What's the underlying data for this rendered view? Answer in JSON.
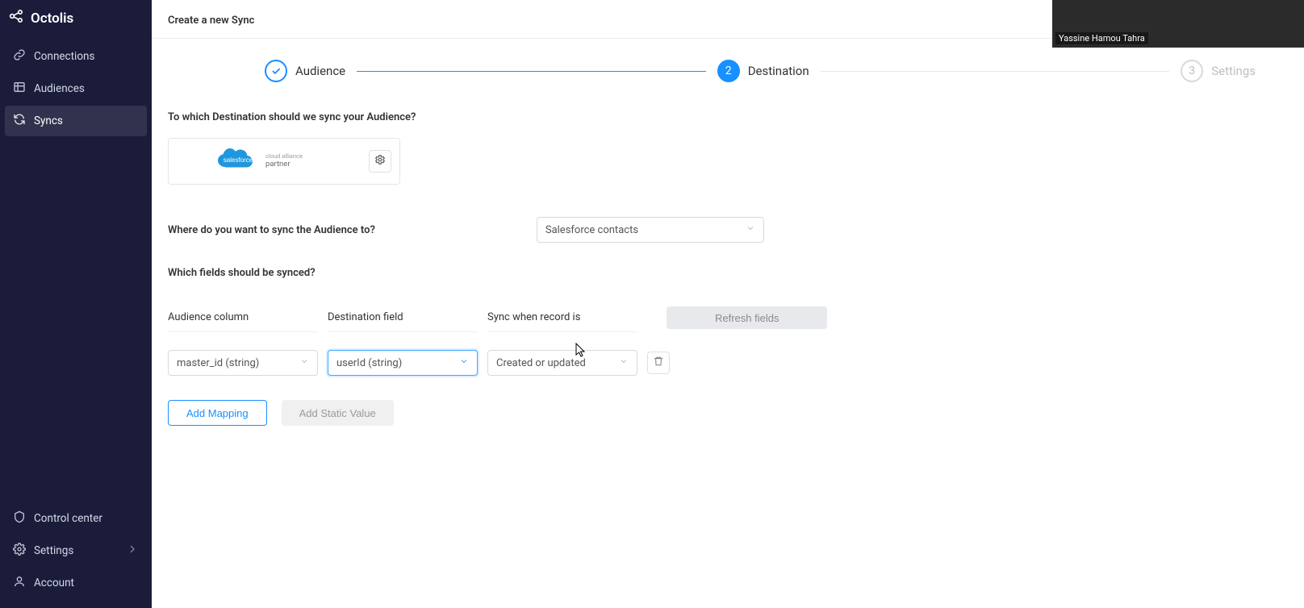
{
  "brand": "Octolis",
  "sidebar": {
    "items": [
      {
        "label": "Connections"
      },
      {
        "label": "Audiences"
      },
      {
        "label": "Syncs"
      }
    ],
    "bottom": [
      {
        "label": "Control center"
      },
      {
        "label": "Settings"
      },
      {
        "label": "Account"
      }
    ]
  },
  "header": {
    "title": "Create a new Sync"
  },
  "steps": {
    "s1": {
      "label": "Audience"
    },
    "s2": {
      "num": "2",
      "label": "Destination"
    },
    "s3": {
      "num": "3",
      "label": "Settings"
    }
  },
  "q1": "To which Destination should we sync your Audience?",
  "dest_card": {
    "cloud_text": "salesforce",
    "line1": "cloud alliance",
    "line2": "partner"
  },
  "q2": "Where do you want to sync the Audience to?",
  "sync_target": "Salesforce contacts",
  "q3": "Which fields should be synced?",
  "mapping_header": {
    "c1": "Audience column",
    "c2": "Destination field",
    "c3": "Sync when record is",
    "refresh": "Refresh fields"
  },
  "mapping_row": {
    "audience_col": "master_id (string)",
    "dest_field": "userId (string)",
    "sync_when": "Created or updated"
  },
  "actions": {
    "add_mapping": "Add Mapping",
    "add_static": "Add Static Value"
  },
  "webcam_name": "Yassine Hamou Tahra"
}
